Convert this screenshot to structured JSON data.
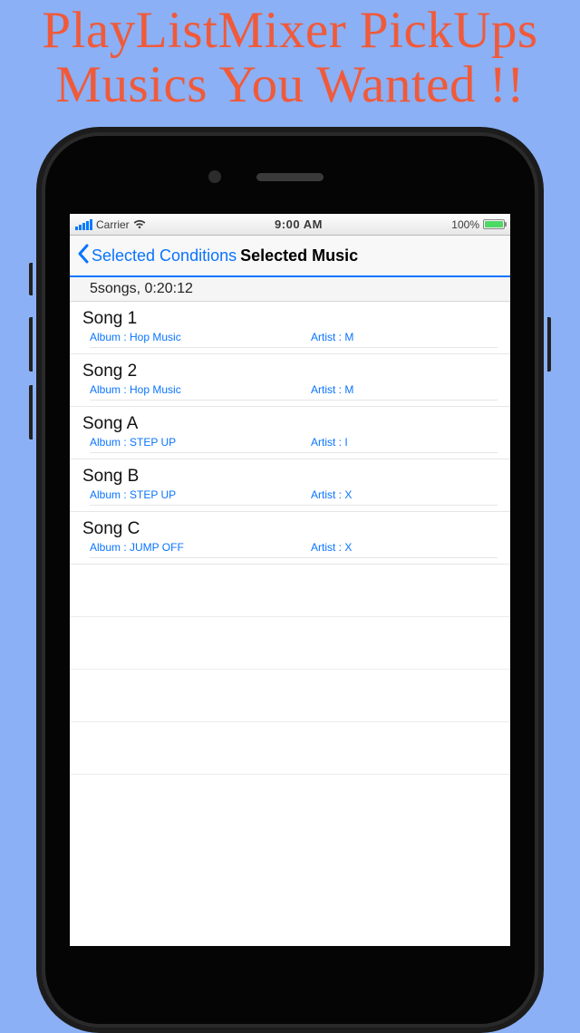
{
  "promo": {
    "line1": "PlayListMixer PickUps",
    "line2": "Musics You Wanted !!"
  },
  "statusbar": {
    "carrier": "Carrier",
    "time": "9:00 AM",
    "battery_pct": "100%"
  },
  "nav": {
    "back_label": "Selected Conditions",
    "title": "Selected Music"
  },
  "summary": "5songs, 0:20:12",
  "album_prefix": "Album :  ",
  "artist_prefix": "Artist : ",
  "songs": [
    {
      "title": "Song 1",
      "album": "Hop Music",
      "artist": "M"
    },
    {
      "title": "Song 2",
      "album": "Hop Music",
      "artist": "M"
    },
    {
      "title": "Song A",
      "album": "STEP UP",
      "artist": "I"
    },
    {
      "title": "Song B",
      "album": "STEP UP",
      "artist": "X"
    },
    {
      "title": "Song C",
      "album": "JUMP OFF",
      "artist": "X"
    }
  ]
}
